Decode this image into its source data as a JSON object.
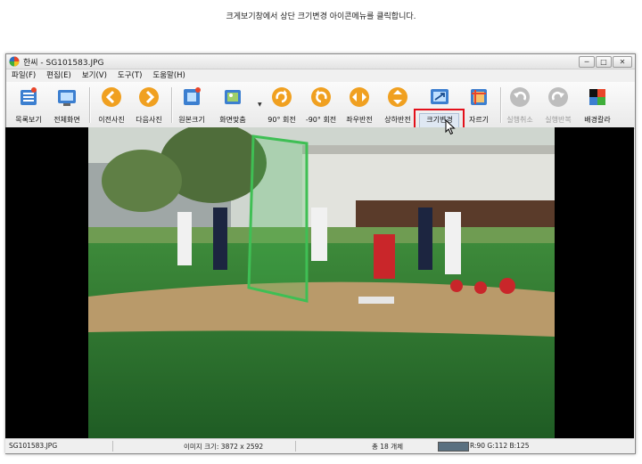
{
  "instruction": "크게보기창에서 상단 크기변경 아이콘메뉴를 클릭합니다.",
  "window": {
    "app_name": "한씨",
    "file_name": "SG101583.JPG",
    "separator": " - "
  },
  "window_controls": {
    "minimize": "─",
    "maximize": "□",
    "close": "✕"
  },
  "menu": [
    "파일(F)",
    "편집(E)",
    "보기(V)",
    "도구(T)",
    "도움말(H)"
  ],
  "toolbar": {
    "list_view": "목록보기",
    "full_screen": "전체화면",
    "prev_photo": "이전사진",
    "next_photo": "다음사진",
    "original_size": "원본크기",
    "fit_screen": "화면맞춤",
    "rotate_90": "90° 회전",
    "rotate_minus_90": "-90° 회전",
    "flip_horizontal": "좌우반전",
    "flip_vertical": "상하반전",
    "resize": "크기변경",
    "crop": "자르기",
    "undo": "실행취소",
    "redo": "실행반복",
    "bg_color": "배경칼라"
  },
  "status": {
    "file_name": "SG101583.JPG",
    "image_size": "이미지 크기: 3872 x 2592",
    "count": "총 18 개체",
    "color_value": "R:90 G:112 B:125",
    "color_swatch": "#5a7080"
  },
  "colors": {
    "highlight": "#e3101a",
    "icon_blue": "#3c7fd0",
    "icon_orange": "#f0a020"
  }
}
